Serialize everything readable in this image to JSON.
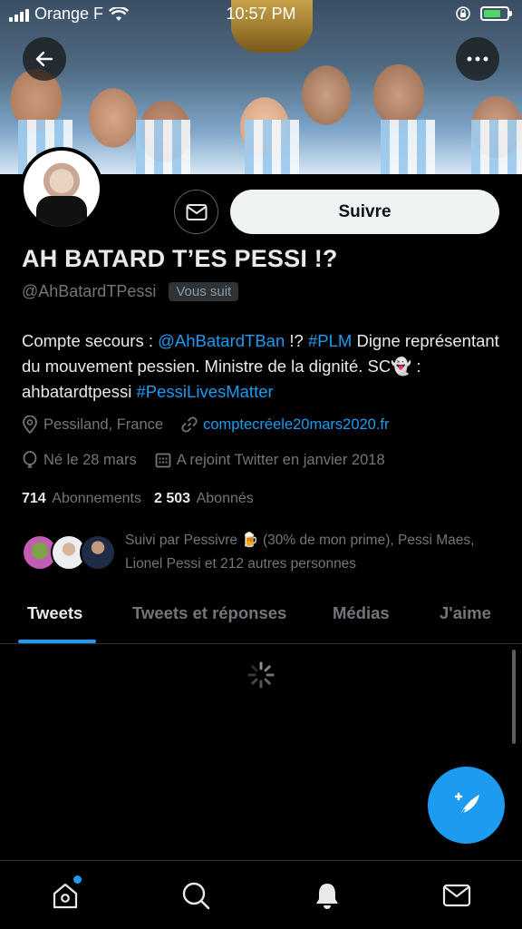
{
  "status_bar": {
    "carrier": "Orange F",
    "time": "10:57 PM"
  },
  "profile": {
    "name": "AH BATARD T’ES PESSI !?",
    "handle": "@AhBatardTPessi",
    "follows_you": "Vous suit",
    "follow_label": "Suivre",
    "bio": [
      {
        "text": "Compte secours : ",
        "type": "text"
      },
      {
        "text": "@AhBatardTBan",
        "type": "link"
      },
      {
        "text": " !? ",
        "type": "text"
      },
      {
        "text": "#PLM",
        "type": "link"
      },
      {
        "text": " Digne représentant du mouvement pessien. Ministre de la dignité. SC👻 : ahbatardtpessi ",
        "type": "text"
      },
      {
        "text": "#PessiLivesMatter",
        "type": "link"
      }
    ],
    "location": "Pessiland, France",
    "website": "comptecréele20mars2020.fr",
    "birthday": "Né le 28 mars",
    "joined": "A rejoint Twitter en janvier 2018",
    "following_count": "714",
    "following_label": "Abonnements",
    "followers_count": "2 503",
    "followers_label": "Abonnés",
    "followed_by": "Suivi par Pessivre 🍺 (30% de mon prime), Pessi Maes, Lionel Pessi et 212 autres personnes"
  },
  "tabs": [
    {
      "label": "Tweets",
      "active": true
    },
    {
      "label": "Tweets et réponses",
      "active": false
    },
    {
      "label": "Médias",
      "active": false
    },
    {
      "label": "J'aime",
      "active": false
    }
  ],
  "icons": {
    "back": "back-arrow-icon",
    "more": "more-icon",
    "message": "envelope-icon",
    "location": "location-pin-icon",
    "link": "link-icon",
    "birthday": "balloon-icon",
    "calendar": "calendar-icon",
    "compose": "compose-tweet-icon",
    "home": "home-icon",
    "search": "search-icon",
    "notifications": "bell-icon",
    "messages": "mail-icon"
  },
  "colors": {
    "accent": "#1d9bf0",
    "background": "#000000",
    "muted_text": "#71767b"
  }
}
